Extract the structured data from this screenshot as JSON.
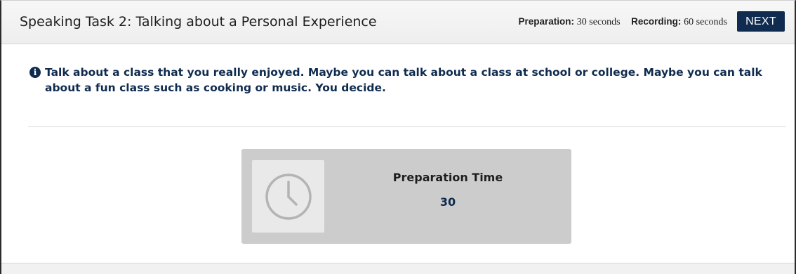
{
  "header": {
    "title": "Speaking Task 2: Talking about a Personal Experience",
    "preparation_label": "Preparation:",
    "preparation_value": "30 seconds",
    "recording_label": "Recording:",
    "recording_value": "60 seconds",
    "next_label": "NEXT"
  },
  "prompt": {
    "icon": "info-icon",
    "info_glyph": "i",
    "text": "Talk about a class that you really enjoyed. Maybe you can talk about a class at school or college. Maybe you can talk about a fun class such as cooking or music. You decide."
  },
  "timer": {
    "icon": "clock-icon",
    "label": "Preparation Time",
    "value": "30"
  },
  "colors": {
    "accent": "#0f2b4f",
    "panel": "#cccccc",
    "tile": "#e9e9e9"
  }
}
